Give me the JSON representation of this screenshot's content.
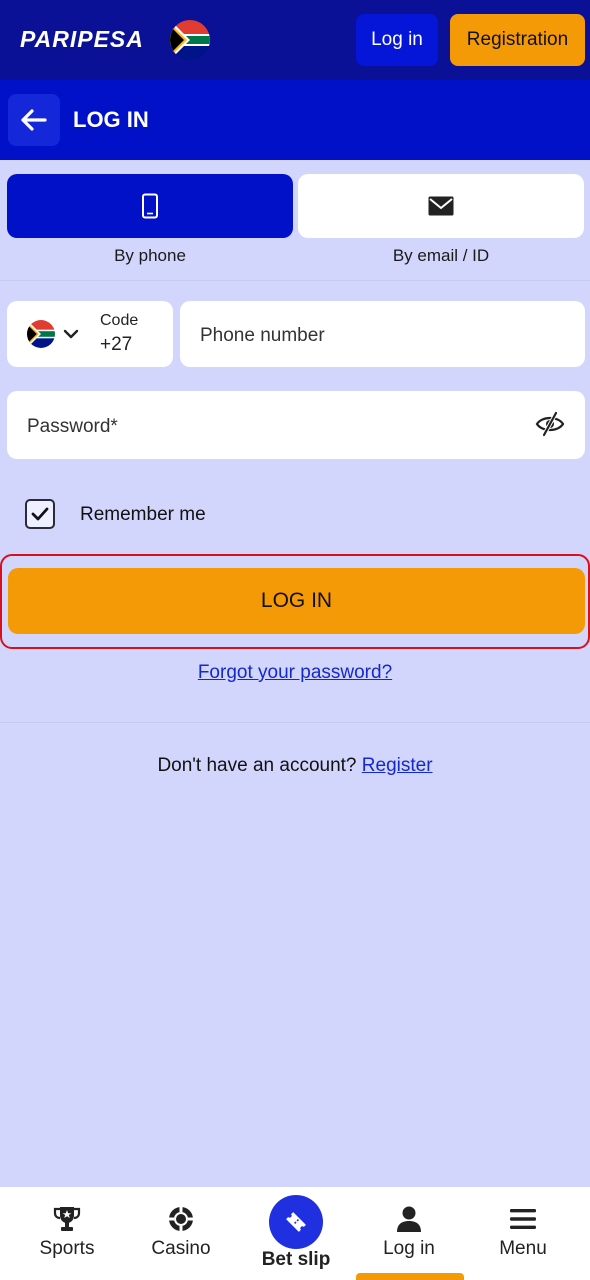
{
  "header": {
    "logo": "PARIPESA",
    "login_label": "Log in",
    "registration_label": "Registration"
  },
  "subheader": {
    "title": "LOG IN"
  },
  "tabs": [
    {
      "label": "By phone",
      "icon": "phone-icon"
    },
    {
      "label": "By email / ID",
      "icon": "envelope-icon"
    }
  ],
  "form": {
    "code_label": "Code",
    "code_value": "+27",
    "phone_placeholder": "Phone number",
    "password_placeholder": "Password*",
    "remember_label": "Remember me",
    "remember_checked": true,
    "submit_label": "LOG IN",
    "forgot_label": "Forgot your password?",
    "no_account_text": "Don't have an account?",
    "register_link": "Register"
  },
  "bottom_nav": {
    "items": [
      {
        "label": "Sports",
        "icon": "trophy-icon"
      },
      {
        "label": "Casino",
        "icon": "casino-chip-icon"
      },
      {
        "label": "Bet slip",
        "icon": "ticket-icon"
      },
      {
        "label": "Log in",
        "icon": "user-icon"
      },
      {
        "label": "Menu",
        "icon": "hamburger-icon"
      }
    ],
    "active": "Log in"
  },
  "colors": {
    "header_bg": "#0a1196",
    "subheader_bg": "#0011c8",
    "accent_orange": "#f59a07",
    "page_bg": "#d3d6fc",
    "highlight_border": "#d8101c"
  }
}
